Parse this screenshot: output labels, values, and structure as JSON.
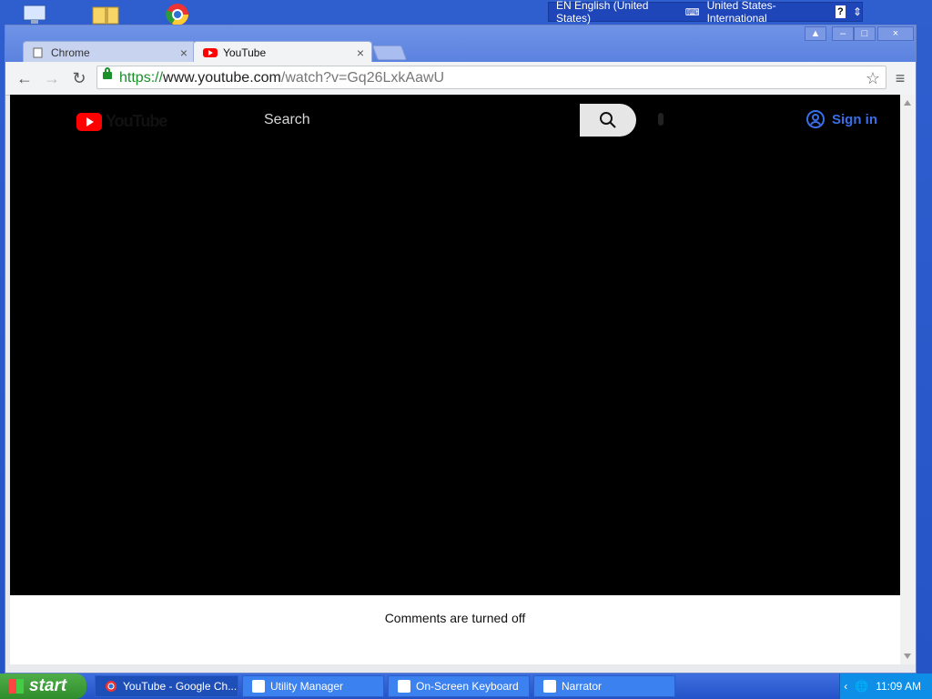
{
  "lang_bar": {
    "language": "EN English (United States)",
    "keyboard": "United States-International",
    "help": "?"
  },
  "browser": {
    "tabs": [
      {
        "label": "Chrome"
      },
      {
        "label": "YouTube"
      }
    ],
    "url": {
      "scheme": "https://",
      "host": "www.youtube.com",
      "path": "/watch?v=Gq26LxkAawU"
    }
  },
  "youtube": {
    "logo_text": "YouTube",
    "search_placeholder": "Search",
    "sign_in": "Sign in",
    "comments": "Comments are turned off"
  },
  "taskbar": {
    "start": "start",
    "tasks": [
      {
        "label": "YouTube - Google Ch..."
      },
      {
        "label": "Utility Manager"
      },
      {
        "label": "On-Screen Keyboard"
      },
      {
        "label": "Narrator"
      }
    ],
    "clock": "11:09 AM"
  },
  "colors": {
    "accent": "#3a6ee8",
    "youtube_red": "#ff0000",
    "secure_green": "#1a8f2a"
  }
}
